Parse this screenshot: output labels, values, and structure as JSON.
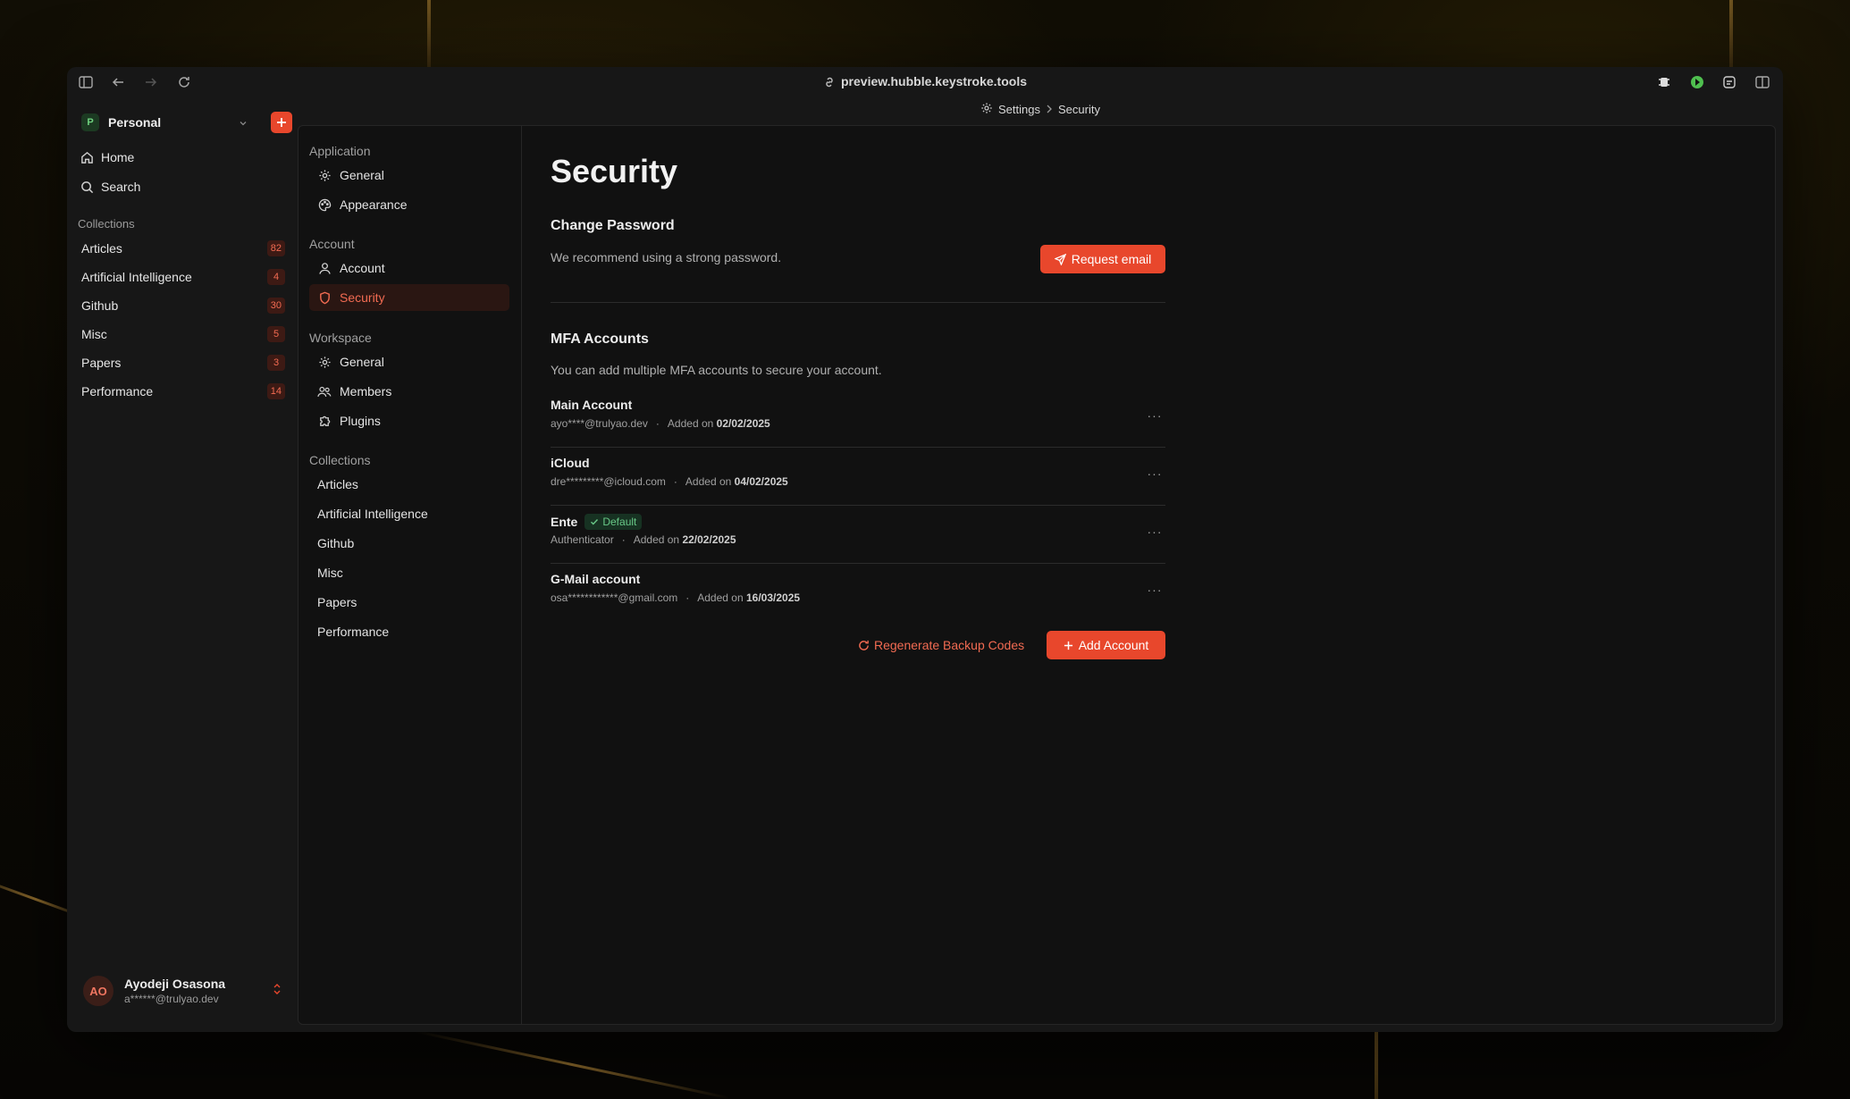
{
  "browser": {
    "url": "preview.hubble.keystroke.tools"
  },
  "workspace": {
    "badge": "P",
    "name": "Personal"
  },
  "sidebar": {
    "nav": [
      {
        "label": "Home",
        "icon": "home-icon"
      },
      {
        "label": "Search",
        "icon": "search-icon"
      }
    ],
    "collections_label": "Collections",
    "collections": [
      {
        "label": "Articles",
        "count": "82"
      },
      {
        "label": "Artificial Intelligence",
        "count": "4"
      },
      {
        "label": "Github",
        "count": "30"
      },
      {
        "label": "Misc",
        "count": "5"
      },
      {
        "label": "Papers",
        "count": "3"
      },
      {
        "label": "Performance",
        "count": "14"
      }
    ]
  },
  "user": {
    "initials": "AO",
    "name": "Ayodeji Osasona",
    "email": "a******@trulyao.dev"
  },
  "breadcrumb": {
    "parent": "Settings",
    "current": "Security"
  },
  "settings_nav": {
    "application_label": "Application",
    "application": [
      {
        "label": "General",
        "icon": "gear-icon"
      },
      {
        "label": "Appearance",
        "icon": "palette-icon"
      }
    ],
    "account_label": "Account",
    "account": [
      {
        "label": "Account",
        "icon": "user-icon"
      },
      {
        "label": "Security",
        "icon": "shield-icon",
        "active": true
      }
    ],
    "workspace_label": "Workspace",
    "workspace": [
      {
        "label": "General",
        "icon": "gear-icon"
      },
      {
        "label": "Members",
        "icon": "users-icon"
      },
      {
        "label": "Plugins",
        "icon": "puzzle-icon"
      }
    ],
    "collections_label": "Collections",
    "collections": [
      "Articles",
      "Artificial Intelligence",
      "Github",
      "Misc",
      "Papers",
      "Performance"
    ]
  },
  "page": {
    "title": "Security",
    "change_password": {
      "heading": "Change Password",
      "description": "We recommend using a strong password.",
      "button": "Request email"
    },
    "mfa": {
      "heading": "MFA Accounts",
      "description": "You can add multiple MFA accounts to secure your account.",
      "added_prefix": "Added on",
      "accounts": [
        {
          "name": "Main Account",
          "identifier": "ayo****@trulyao.dev",
          "date": "02/02/2025",
          "badge": ""
        },
        {
          "name": "iCloud",
          "identifier": "dre*********@icloud.com",
          "date": "04/02/2025",
          "badge": ""
        },
        {
          "name": "Ente",
          "identifier": "Authenticator",
          "date": "22/02/2025",
          "badge": "Default"
        },
        {
          "name": "G-Mail account",
          "identifier": "osa************@gmail.com",
          "date": "16/03/2025",
          "badge": ""
        }
      ],
      "regenerate_button": "Regenerate Backup Codes",
      "add_button": "Add Account"
    }
  },
  "colors": {
    "accent": "#e8472c",
    "success": "#68c887"
  }
}
